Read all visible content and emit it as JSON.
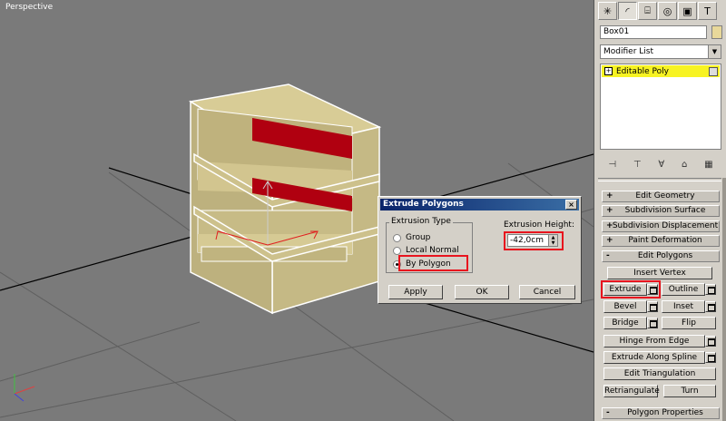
{
  "viewport": {
    "label": "Perspective"
  },
  "command_panel": {
    "tabs": [
      "create-icon",
      "modify-icon",
      "hierarchy-icon",
      "motion-icon",
      "display-icon",
      "utilities-icon"
    ],
    "object_name": "Box01",
    "object_color": "#e8d89a",
    "modifier_list": "Modifier List",
    "stack_item": "Editable Poly",
    "rollouts": {
      "edit_geometry": "Edit Geometry",
      "subdivision_surface": "Subdivision Surface",
      "subdivision_displacement": "Subdivision Displacement",
      "paint_deformation": "Paint Deformation",
      "edit_polygons": "Edit Polygons",
      "polygon_properties": "Polygon Properties"
    },
    "buttons": {
      "insert_vertex": "Insert Vertex",
      "extrude": "Extrude",
      "outline": "Outline",
      "bevel": "Bevel",
      "inset": "Inset",
      "bridge": "Bridge",
      "flip": "Flip",
      "hinge_from_edge": "Hinge From Edge",
      "extrude_along_spline": "Extrude Along Spline",
      "edit_triangulation": "Edit Triangulation",
      "retriangulate": "Retriangulate",
      "turn": "Turn"
    }
  },
  "dialog": {
    "title": "Extrude Polygons",
    "close": "×",
    "extrusion_type_label": "Extrusion Type",
    "options": [
      "Group",
      "Local Normal",
      "By Polygon"
    ],
    "selected_option": "By Polygon",
    "height_label": "Extrusion Height:",
    "height_value": "-42,0cm",
    "apply": "Apply",
    "ok": "OK",
    "cancel": "Cancel"
  },
  "colors": {
    "accent_highlight": "#e8141e",
    "selection_yellow": "#f7f323",
    "object_tan": "#c9bd88",
    "selected_faces": "#b00010"
  }
}
